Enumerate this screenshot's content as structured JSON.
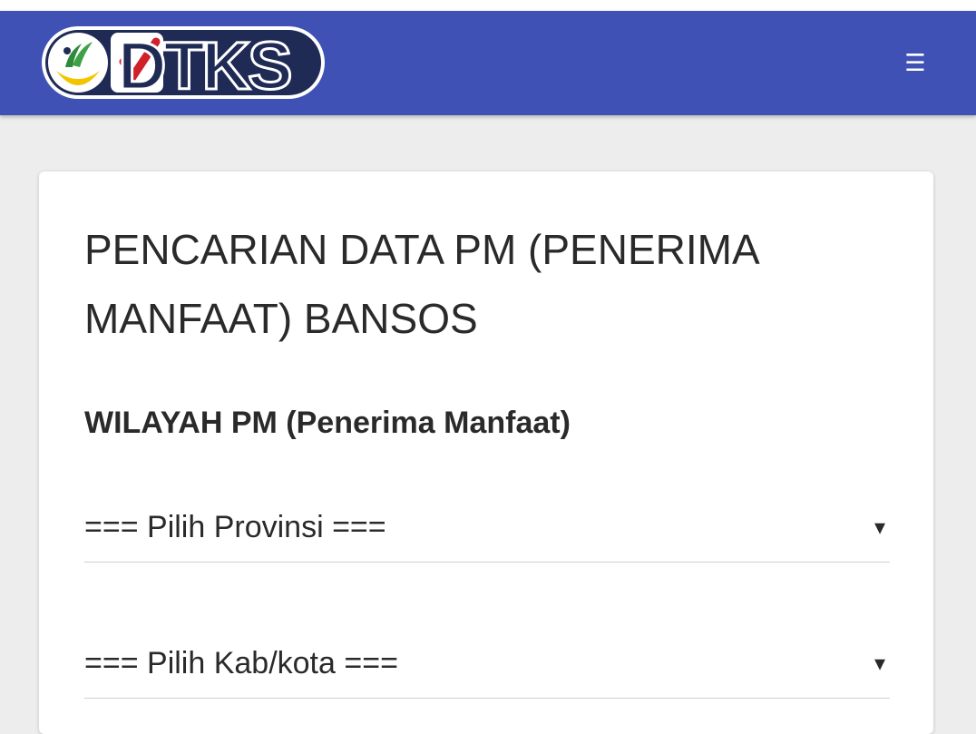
{
  "header": {
    "logo_text": "DTKS",
    "menu_icon": "menu-icon",
    "menu_glyph": "☰",
    "color": "#3f51b5"
  },
  "main": {
    "title": "PENCARIAN DATA PM (PENERIMA MANFAAT) BANSOS",
    "section_title": "WILAYAH PM (Penerima Manfaat)",
    "province_select": {
      "value": "=== Pilih Provinsi ===",
      "caret_icon": "chevron-down-icon"
    },
    "city_select": {
      "value": "=== Pilih Kab/kota ===",
      "caret_icon": "chevron-down-icon"
    },
    "caret_glyph": "▾"
  }
}
